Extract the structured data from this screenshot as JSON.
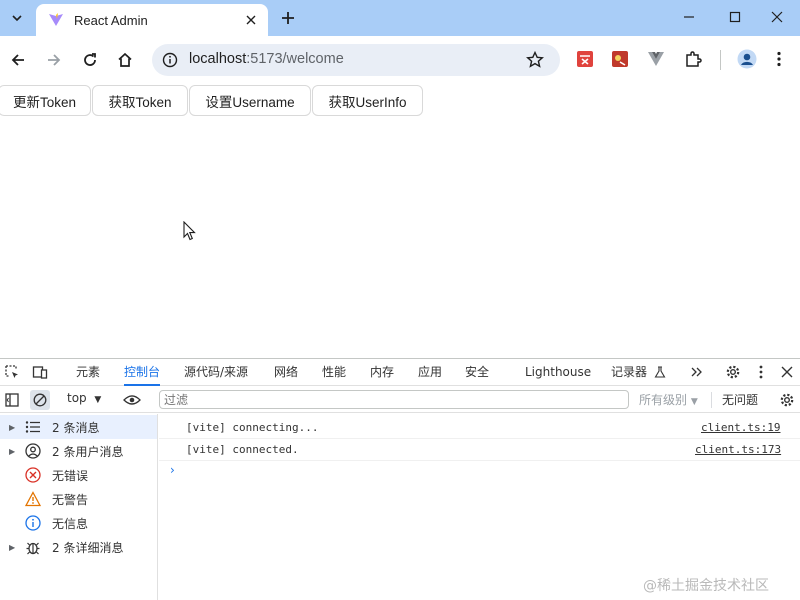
{
  "browser": {
    "tab_title": "React Admin",
    "url_host": "localhost",
    "url_rest": ":5173/welcome"
  },
  "page": {
    "buttons": [
      "更新Token",
      "获取Token",
      "设置Username",
      "获取UserInfo"
    ]
  },
  "devtools": {
    "tabs": [
      "元素",
      "控制台",
      "源代码/来源",
      "网络",
      "性能",
      "内存",
      "应用",
      "安全",
      "Lighthouse",
      "记录器"
    ],
    "active_tab": "控制台",
    "context": "top",
    "filter_placeholder": "过滤",
    "levels": "所有级别",
    "issues": "无问题",
    "sidebar": [
      {
        "label": "2 条消息",
        "icon": "list-icon"
      },
      {
        "label": "2 条用户消息",
        "icon": "user-icon"
      },
      {
        "label": "无错误",
        "icon": "error-icon"
      },
      {
        "label": "无警告",
        "icon": "warning-icon"
      },
      {
        "label": "无信息",
        "icon": "info-icon"
      },
      {
        "label": "2 条详细消息",
        "icon": "bug-icon"
      }
    ],
    "logs": [
      {
        "text": "[vite] connecting...",
        "source": "client.ts:19"
      },
      {
        "text": "[vite] connected.",
        "source": "client.ts:173"
      }
    ]
  },
  "watermark": "@稀土掘金技术社区",
  "colors": {
    "accent": "#1a73e8",
    "tabstrip": "#a9cdf7"
  }
}
